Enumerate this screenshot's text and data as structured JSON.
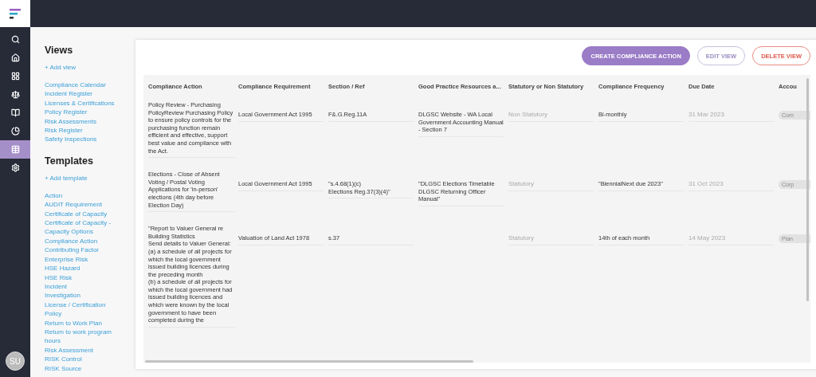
{
  "nav": [
    {
      "selected": false
    },
    {
      "selected": false
    },
    {
      "selected": false
    },
    {
      "selected": false
    },
    {
      "selected": false
    },
    {
      "selected": false
    },
    {
      "selected": true
    },
    {
      "selected": false
    }
  ],
  "avatar": "SU",
  "views": {
    "title": "Views",
    "add": "+ Add view",
    "items": [
      "Compliance Calendar",
      "Incident Register",
      "Licenses & Certifications",
      "Policy Register",
      "Risk Assessments",
      "Risk Register",
      "Safety Inspections"
    ]
  },
  "templates": {
    "title": "Templates",
    "add": "+ Add template",
    "items": [
      "Action",
      "AUDIT Requirement",
      "Certificate of Capacity",
      "Certificate of Capacity - Capacity Options",
      "Compliance Action",
      "Contributing Factor",
      "Enterprise Risk",
      "HSE Hazard",
      "HSE Risk",
      "Incident",
      "Investigation",
      "License / Certification",
      "Policy",
      "Return to Work Plan",
      "Return to work program hours",
      "Risk Assessment",
      "RISK Control",
      "RISK Source"
    ]
  },
  "buttons": [
    {
      "label": "CREATE COMPLIANCE ACTION",
      "kind": "primary"
    },
    {
      "label": "EDIT VIEW",
      "kind": "outline"
    },
    {
      "label": "DELETE VIEW",
      "kind": "danger"
    }
  ],
  "table": {
    "columns": [
      "Compliance Action",
      "Compliance Requirement",
      "Section / Ref",
      "Good Practice Resources a...",
      "Statutory or Non Statutory",
      "Compliance Frequency",
      "Due Date",
      "Accou"
    ],
    "rows": [
      {
        "cells": [
          {
            "kind": "text",
            "text": "Policy Review - Purchasing PolicyReview Purchasing Policy to ensure policy controls for the purchasing function remain efficient and effective, support best value and compliance with the Act."
          },
          {
            "kind": "text",
            "text": "Local Government Act 1995"
          },
          {
            "kind": "text",
            "text": "F&.G.Reg.11A"
          },
          {
            "kind": "text",
            "text": "DLGSC Website - WA Local Government Accounting Manual - Section 7"
          },
          {
            "kind": "readonly",
            "text": "Non Statutory"
          },
          {
            "kind": "text",
            "text": "Bi-monthly"
          },
          {
            "kind": "readonly",
            "text": "31 Mar 2023"
          },
          {
            "kind": "chip",
            "text": "Com"
          }
        ]
      },
      {
        "cells": [
          {
            "kind": "text",
            "text": "Elections - Close of Absent Voting / Postal Voting Applications for 'in-person' elections (4th day before Election Day)"
          },
          {
            "kind": "text",
            "text": "Local Government Act 1995"
          },
          {
            "kind": "text",
            "text": "\"s.4.68(1)(c)\nElections Reg.37(3)(4)\""
          },
          {
            "kind": "text",
            "text": "\"DLGSC Elections Timetable DLGSC Returning Officer Manual\""
          },
          {
            "kind": "readonly",
            "text": "Statutory"
          },
          {
            "kind": "text",
            "text": "\"BiennialNext due 2023\""
          },
          {
            "kind": "readonly",
            "text": "31 Oct 2023"
          },
          {
            "kind": "chip",
            "text": "Corp"
          }
        ]
      },
      {
        "cells": [
          {
            "kind": "text",
            "text": "\"Report to Valuer General re Building Statistics\nSend details to Valuer General:\n(a) a schedule of all projects for which the local government issued building licences during the preceding month\n(b) a schedule of all projects for which the local government had issued building licences and which were known by the local government to have been completed during the"
          },
          {
            "kind": "text",
            "text": "Valuation of Land Act 1978"
          },
          {
            "kind": "text",
            "text": "s.37"
          },
          {
            "kind": "empty"
          },
          {
            "kind": "readonly",
            "text": "Statutory"
          },
          {
            "kind": "text",
            "text": "14th of each month"
          },
          {
            "kind": "readonly",
            "text": "14 May 2023"
          },
          {
            "kind": "chip",
            "text": "Plan"
          }
        ]
      }
    ]
  }
}
